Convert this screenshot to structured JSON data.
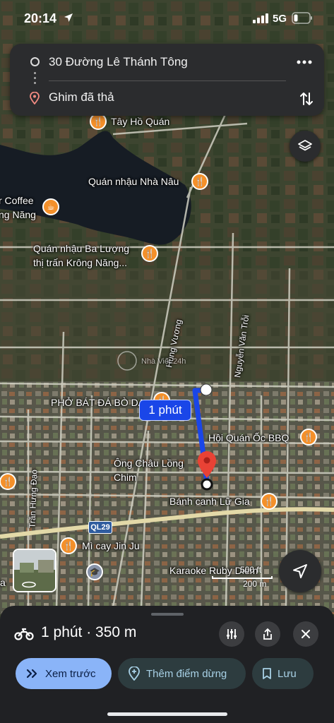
{
  "status_bar": {
    "time": "20:14",
    "network": "5G"
  },
  "route": {
    "origin": "30 Đường Lê Thánh Tông",
    "destination": "Ghim đã thả",
    "badge": "1 phút"
  },
  "map_labels": {
    "poi_tay_ho": "Tây Hồ Quán",
    "poi_nha_nau": "Quán nhậu Nhà Nâu",
    "poi_coffee_line1": "r Coffee",
    "poi_coffee_line2": "ng Năng",
    "poi_ba_luong_line1": "Quán nhậu Ba Lượng",
    "poi_ba_luong_line2": "thị trấn Krông Năng...",
    "street_hung_vuong": "Hùng Vương",
    "street_nguyen_van_troi": "Nguyễn Văn Trỗi",
    "poi_pho": "PHỞ BÁT ĐÁ BÒ DA",
    "poi_hoi_quan": "Hội Quán Ốc BBQ",
    "poi_ong_chau_line1": "Ông Châu Lồng",
    "poi_ong_chau_line2": "Chim",
    "street_tran_hung_dao": "Trần Hưng Đạo",
    "poi_banh_canh": "Bánh canh Lữ Gia",
    "road_ql29": "QL29",
    "poi_mi_cay": "Mì cay Jin Ju",
    "poi_karaoke": "Karaoke Ruby Diem",
    "poi_cut_left": "a",
    "watermark": "Nhà Việt 24h"
  },
  "scale": {
    "top": "500 ft",
    "bottom": "200 m"
  },
  "sheet": {
    "summary": "1 phút · 350 m",
    "preview_label": "Xem trước",
    "add_stop_label": "Thêm điểm dừng",
    "save_label": "Lưu"
  },
  "colors": {
    "route_line": "#1a46e8",
    "destination_pin": "#e84235",
    "poi_orange": "#f4902a",
    "accent_blue": "#8ab4f8",
    "sheet_bg": "#202124"
  },
  "icons": {
    "location_arrow": "navigation-arrow-icon",
    "layers": "layers-icon",
    "locate": "my-location-icon",
    "motorbike": "motorbike-icon",
    "options": "sliders-icon",
    "share": "share-icon",
    "close": "close-icon",
    "preview": "double-chevron-icon",
    "add_stop": "add-place-icon",
    "save": "bookmark-icon"
  }
}
